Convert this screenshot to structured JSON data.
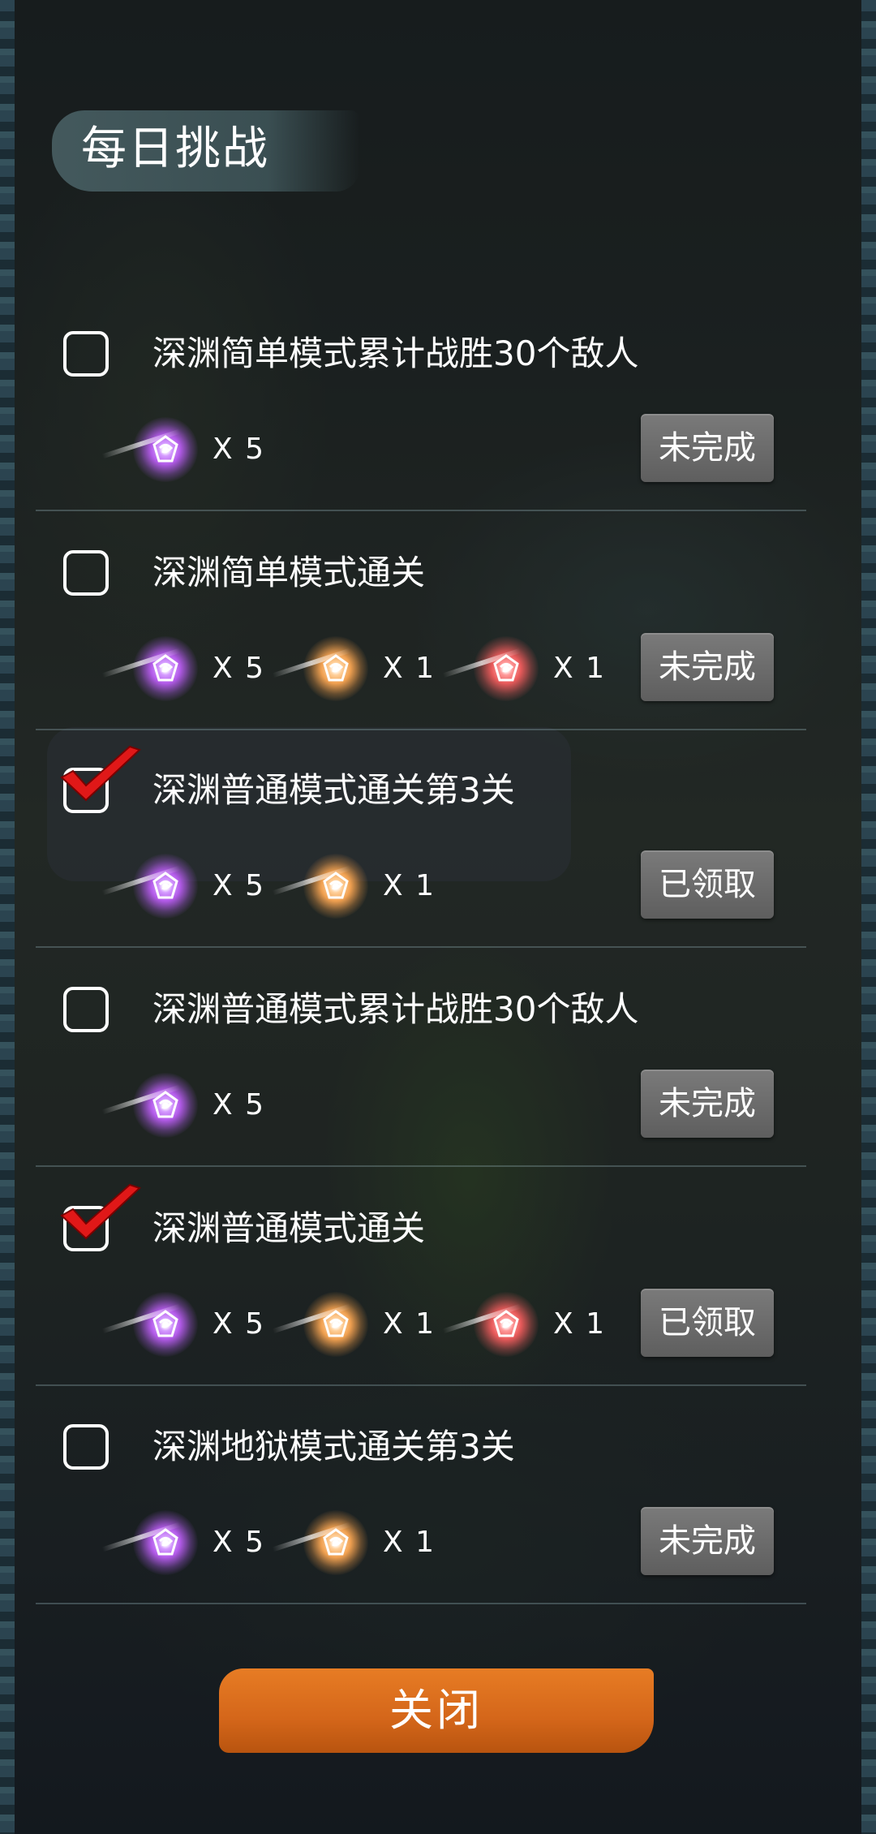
{
  "title": "每日挑战",
  "close_label": "关闭",
  "colors": {
    "gem_purple": "#b25ae8",
    "gem_orange": "#f0a050",
    "gem_red": "#e85a5a",
    "close_bar": "#e07020",
    "status_button": "#6a6a6a"
  },
  "tasks": [
    {
      "text": "深渊简单模式累计战胜30个敌人",
      "checked": false,
      "status": "未完成",
      "rewards": [
        {
          "gem": "purple",
          "qty": "X 5"
        }
      ]
    },
    {
      "text": "深渊简单模式通关",
      "checked": false,
      "status": "未完成",
      "rewards": [
        {
          "gem": "purple",
          "qty": "X 5"
        },
        {
          "gem": "orange",
          "qty": "X 1"
        },
        {
          "gem": "red",
          "qty": "X 1"
        }
      ]
    },
    {
      "text": "深渊普通模式通关第3关",
      "checked": true,
      "status": "已领取",
      "rewards": [
        {
          "gem": "purple",
          "qty": "X 5"
        },
        {
          "gem": "orange",
          "qty": "X 1"
        }
      ]
    },
    {
      "text": "深渊普通模式累计战胜30个敌人",
      "checked": false,
      "status": "未完成",
      "rewards": [
        {
          "gem": "purple",
          "qty": "X 5"
        }
      ]
    },
    {
      "text": "深渊普通模式通关",
      "checked": true,
      "status": "已领取",
      "rewards": [
        {
          "gem": "purple",
          "qty": "X 5"
        },
        {
          "gem": "orange",
          "qty": "X 1"
        },
        {
          "gem": "red",
          "qty": "X 1"
        }
      ]
    },
    {
      "text": "深渊地狱模式通关第3关",
      "checked": false,
      "status": "未完成",
      "rewards": [
        {
          "gem": "purple",
          "qty": "X 5"
        },
        {
          "gem": "orange",
          "qty": "X 1"
        }
      ]
    }
  ]
}
